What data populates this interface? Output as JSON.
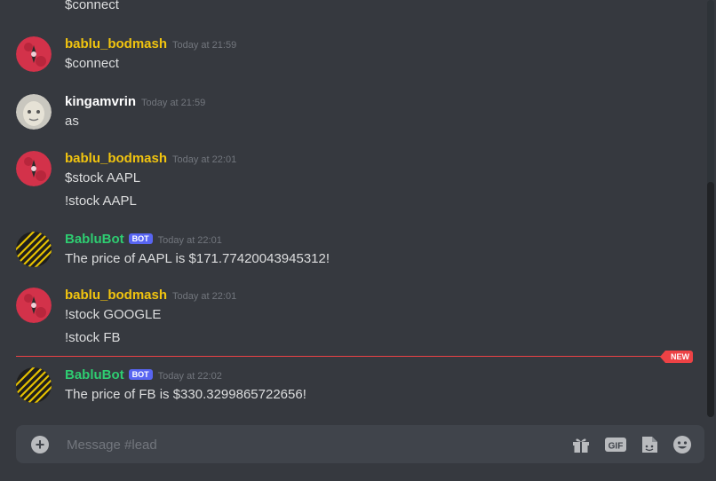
{
  "chat": {
    "top_continuation": "$connect",
    "messages": [
      {
        "author": "bablu_bodmash",
        "timestamp": "Today at 21:59",
        "lines": [
          "$connect"
        ]
      },
      {
        "author": "kingamvrin",
        "timestamp": "Today at 21:59",
        "lines": [
          "as"
        ]
      },
      {
        "author": "bablu_bodmash",
        "timestamp": "Today at 22:01",
        "lines": [
          "$stock AAPL",
          "!stock AAPL"
        ]
      },
      {
        "author": "BabluBot",
        "bot_tag": "BOT",
        "timestamp": "Today at 22:01",
        "lines": [
          "The price of AAPL is $171.77420043945312!"
        ]
      },
      {
        "author": "bablu_bodmash",
        "timestamp": "Today at 22:01",
        "lines": [
          "!stock GOOGLE",
          "!stock FB"
        ]
      },
      {
        "author": "BabluBot",
        "bot_tag": "BOT",
        "timestamp": "Today at 22:02",
        "lines": [
          "The price of FB is $330.3299865722656!"
        ]
      }
    ],
    "new_divider_label": "NEW"
  },
  "composer": {
    "placeholder": "Message #lead",
    "gif_label": "GIF"
  },
  "colors": {
    "background": "#36393f",
    "composer": "#40444b",
    "username_yellow": "#f1c40f",
    "username_green": "#2ecc71",
    "bot_badge": "#5865f2",
    "new_divider": "#ed4245"
  },
  "icons": [
    "add-attachment-icon",
    "gift-icon",
    "gif-icon",
    "sticker-icon",
    "emoji-icon"
  ]
}
